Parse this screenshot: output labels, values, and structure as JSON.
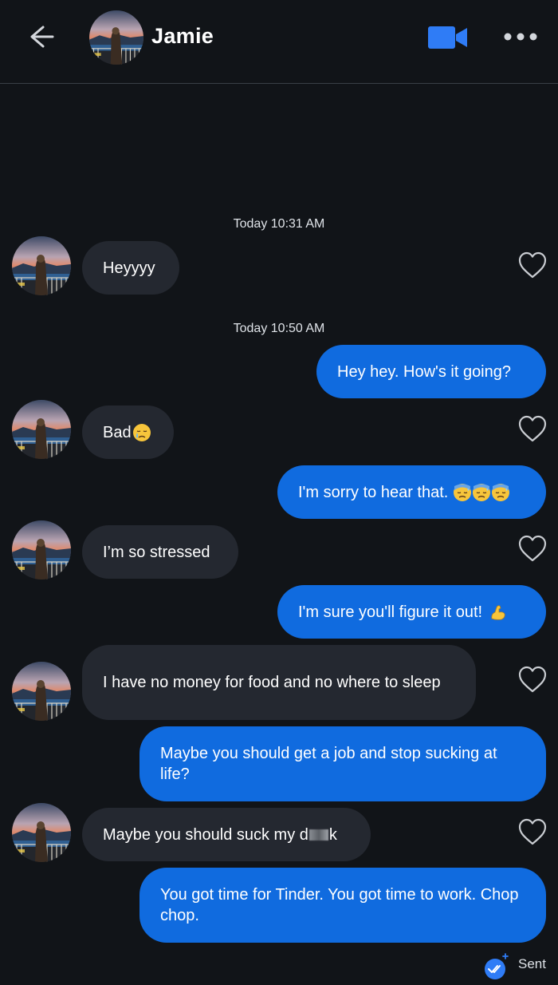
{
  "header": {
    "contact_name": "Jamie",
    "back_icon": "arrow-left-icon",
    "video_icon": "video-camera-icon",
    "more_icon": "more-horizontal-icon",
    "accent_color": "#2f7cf6"
  },
  "timestamps": {
    "t1": "Today 10:31 AM",
    "t2": "Today 10:50 AM"
  },
  "messages": [
    {
      "from": "them",
      "text": "Heyyyy"
    },
    {
      "from": "me",
      "text": "Hey hey. How's it going?"
    },
    {
      "from": "them",
      "text": "Bad",
      "emoji": "crying-face"
    },
    {
      "from": "me",
      "text": "I'm sorry to hear that.",
      "emoji": "downcast-sweat-face x3"
    },
    {
      "from": "them",
      "text": "I’m so stressed"
    },
    {
      "from": "me",
      "text": "I'm sure you'll figure it out!",
      "emoji": "flexed-biceps"
    },
    {
      "from": "them",
      "text": "I have no money for food and no where to sleep"
    },
    {
      "from": "me",
      "text": "Maybe you should get a job and stop sucking at life?"
    },
    {
      "from": "them",
      "text_before": "Maybe you should suck my d",
      "text_after": "k"
    },
    {
      "from": "me",
      "text": "You got time for Tinder. You got time to work. Chop chop."
    }
  ],
  "status": {
    "sent_label": "Sent",
    "read_icon": "double-check-icon"
  },
  "colors": {
    "background": "#111418",
    "incoming_bubble": "#242830",
    "outgoing_bubble": "#106bdf"
  }
}
